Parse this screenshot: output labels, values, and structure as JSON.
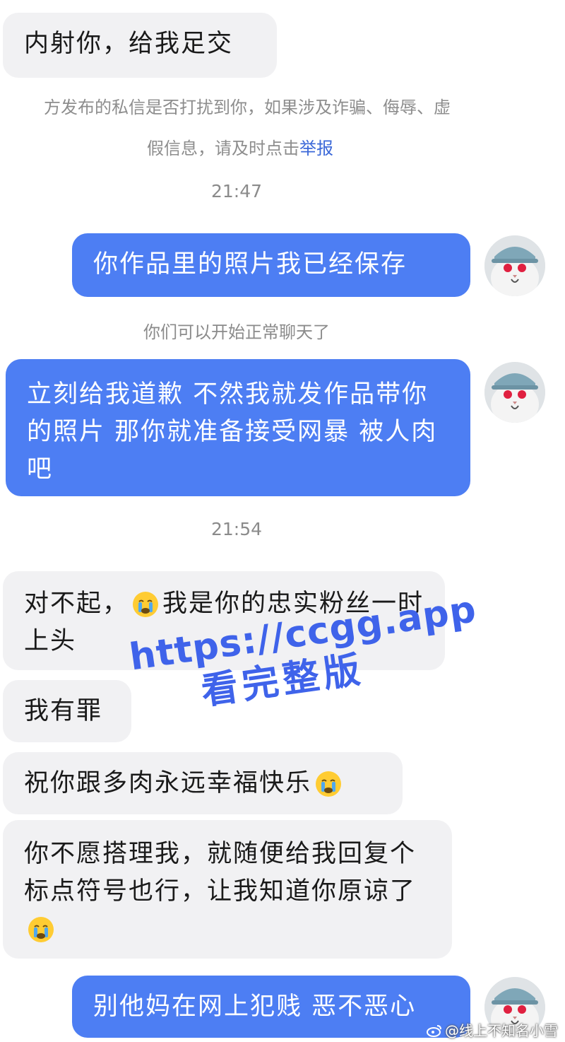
{
  "messages": {
    "m1": "内射你，给我足交",
    "m2": "你作品里的照片我已经保存",
    "m3": "立刻给我道歉 不然我就发作品带你的照片 那你就准备接受网暴 被人肉吧",
    "m4a": "对不起，",
    "m4b": "我是你的忠实粉丝一时上头",
    "m5": "我有罪",
    "m6": "祝你跟多肉永远幸福快乐",
    "m7": "你不愿搭理我，就随便给我回复个标点符号也行，让我知道你原谅了",
    "m8": "别他妈在网上犯贱 恶不恶心"
  },
  "notice": {
    "line1": "方发布的私信是否打扰到你，如果涉及诈骗、侮辱、虚",
    "line2_prefix": "假信息，请及时点击",
    "report_label": "举报"
  },
  "timestamps": {
    "t1": "21:47",
    "t2": "21:54"
  },
  "system_tip": "你们可以开始正常聊天了",
  "watermark": {
    "line1": "https://ccgg.app",
    "line2": "看完整版"
  },
  "credit": "@线上不知名小雪",
  "colors": {
    "outgoing_bubble": "#4d7ef3",
    "incoming_bubble": "#f1f1f3",
    "link": "#3b68d8",
    "watermark": "#3f63ea"
  },
  "icons": {
    "emoji": "crying-face-icon",
    "credit": "weibo-logo-icon"
  }
}
